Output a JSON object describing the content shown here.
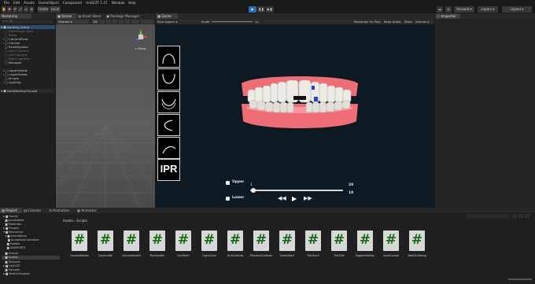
{
  "menu": [
    "File",
    "Edit",
    "Assets",
    "GameObject",
    "Component",
    "UniGLTF 1.27",
    "Window",
    "Help"
  ],
  "toolbar": {
    "center_label": "Center",
    "local_label": "Local",
    "account_label": "Account",
    "layers_label": "Layers",
    "layout_label": "Layout"
  },
  "hierarchy": {
    "tab": "Hierarchy",
    "search_placeholder": "All",
    "scene_name": "working_scene",
    "items": [
      "Directional Light",
      "Plane",
      "CameraPivot",
      "Canvas",
      "EventSystem",
      "Main Camera",
      "Left Camera",
      "Right Camera",
      "Manager",
      "UpperHands",
      "LowerHands",
      "Scripts",
      "Lighting"
    ],
    "dont_destroy": "DontDestroyOnLoad"
  },
  "scene_view": {
    "tabs": [
      "Scene",
      "Asset Store",
      "Package Manager"
    ],
    "shading_mode": "Shaded",
    "mode_2d": "2D",
    "gizmo_label": "< Persp"
  },
  "game_view": {
    "tab": "Game",
    "display": "Free Aspect",
    "scale_label": "Scale",
    "scale_value": "1x",
    "options": [
      "Maximize On Play",
      "Mute Audio",
      "Stats",
      "Gizmos"
    ],
    "ipr_label": "IPR",
    "upper_label": "Upper",
    "lower_label": "Lower",
    "slider_min": "1",
    "upper_value": "20",
    "lower_value": "10",
    "slider_progress": 0.03
  },
  "inspector": {
    "tab": "Inspector"
  },
  "bottom": {
    "tabs": [
      "Project",
      "Console",
      "Animation",
      "Animator"
    ],
    "breadcrumb": [
      "Assets",
      "Scripts"
    ],
    "folders": [
      "Hands",
      "JsonDotNet",
      "Materials",
      "Plugins",
      "Resources",
      "Animations",
      "AnimationController",
      "Models",
      "UIIMPORTS",
      "Scenes",
      "Scripts",
      "Textures",
      "UniGLTF",
      "Uploads",
      "WebGLSupport"
    ],
    "assets": [
      "CameraRotate",
      "CameraUtil",
      "CameraSwitch",
      "FileHandler",
      "GenTeeth",
      "OpenClose",
      "GridControls",
      "PlaybackControls",
      "SceneStart",
      "TheTouch",
      "TheTVle",
      "ToggleVisibility",
      "InputControl",
      "WebGLSetting"
    ]
  },
  "colors": {
    "game_bg": "#0d1a24",
    "gum": "#ef6e76",
    "tooth": "#eceae4",
    "script_icon_green": "#1b6b1b",
    "accent_blue": "#2d4b6a"
  }
}
